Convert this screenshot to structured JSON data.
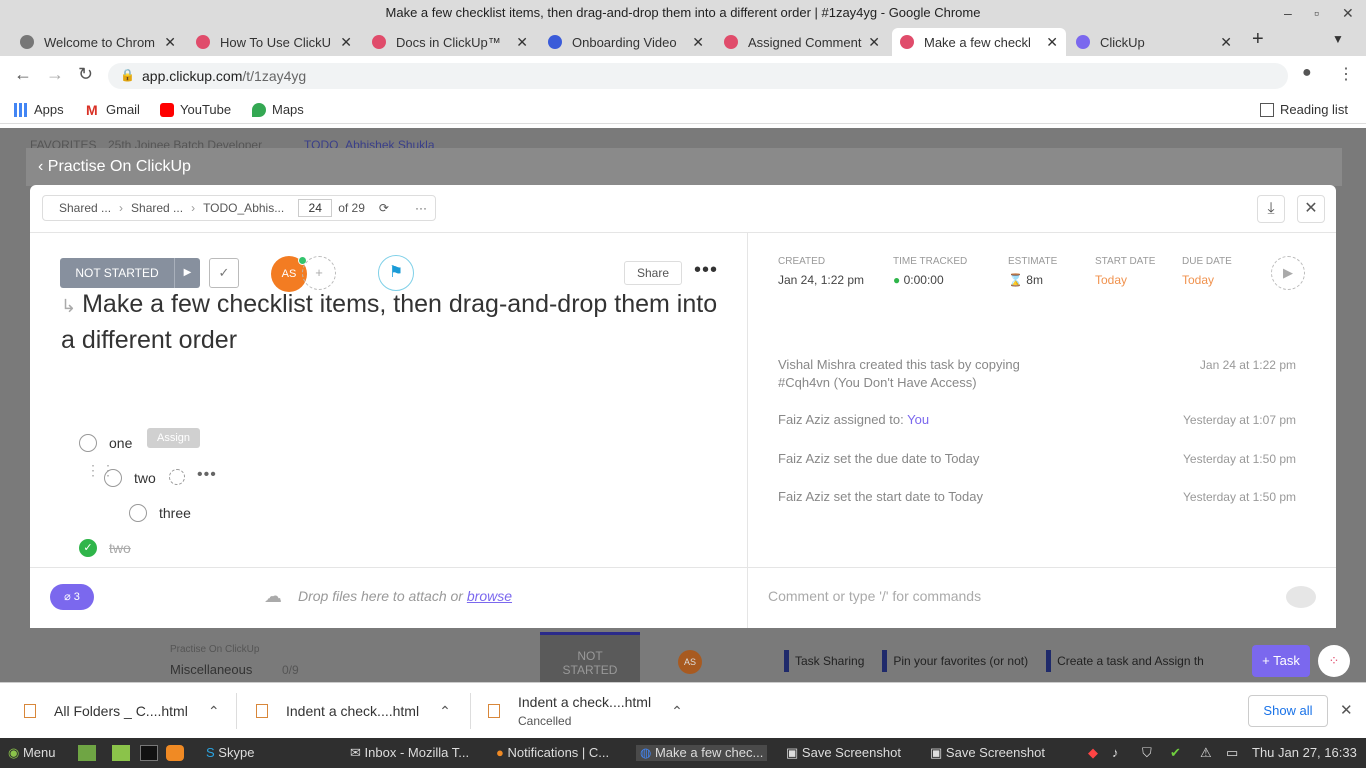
{
  "window": {
    "title": "Make a few checklist items, then drag-and-drop them into a different order | #1zay4yg - Google Chrome"
  },
  "tabs": [
    {
      "label": "Welcome to Chrom",
      "color": "#4285f4"
    },
    {
      "label": "How To Use ClickU",
      "color": "#e04c6b"
    },
    {
      "label": "Docs in ClickUp™",
      "color": "#e04c6b"
    },
    {
      "label": "Onboarding Video",
      "color": "#3a5bd9"
    },
    {
      "label": "Assigned Comment",
      "color": "#e04c6b"
    },
    {
      "label": "Make a few checkl",
      "color": "#e04c6b"
    },
    {
      "label": "ClickUp",
      "color": "#7b68ee"
    }
  ],
  "address": {
    "host": "app.clickup.com",
    "path": "/t/1zay4yg"
  },
  "bookmarks": {
    "apps": "Apps",
    "gmail": "Gmail",
    "youtube": "YouTube",
    "maps": "Maps",
    "reading_list": "Reading list"
  },
  "background": {
    "favorites": "FAVORITES",
    "batch": "25th Joinee Batch Developer",
    "todo": "TODO_Abhishek Shukla",
    "practise_small": "Practise On ClickUp",
    "misc": "Miscellaneous",
    "misc_count": "0/9",
    "not_started_1": "NOT",
    "not_started_2": "STARTED",
    "avatar": "AS",
    "chips": [
      "Task Sharing",
      "Pin your favorites (or not)",
      "Create a task and Assign th"
    ],
    "task_button": "Task"
  },
  "overlay": {
    "title": "Practise On ClickUp"
  },
  "breadcrumb": {
    "items": [
      "Shared ...",
      "Shared ...",
      "TODO_Abhis..."
    ],
    "index": "24",
    "of": "of 29"
  },
  "task": {
    "status": "NOT STARTED",
    "avatar": "AS",
    "share": "Share",
    "title": "Make a few checklist items, then drag-and-drop them into a different order"
  },
  "meta": {
    "created_label": "CREATED",
    "created": "Jan 24, 1:22 pm",
    "tracked_label": "TIME TRACKED",
    "tracked": "0:00:00",
    "estimate_label": "ESTIMATE",
    "estimate": "8m",
    "start_label": "START DATE",
    "start": "Today",
    "due_label": "DUE DATE",
    "due": "Today"
  },
  "checklist": {
    "tooltip": "Assign",
    "items": [
      {
        "text": "one",
        "done": false
      },
      {
        "text": "two",
        "done": false
      },
      {
        "text": "three",
        "done": false
      },
      {
        "text": "two",
        "done": true
      }
    ]
  },
  "activity": [
    {
      "text": "Vishal Mishra created this task by copying #Cqh4vn (You Don't Have Access)",
      "time": "Jan 24 at 1:22 pm"
    },
    {
      "text": "Faiz Aziz assigned to: ",
      "you": "You",
      "time": "Yesterday at 1:07 pm"
    },
    {
      "text": "Faiz Aziz set the due date to Today",
      "time": "Yesterday at 1:50 pm"
    },
    {
      "text": "Faiz Aziz set the start date to Today",
      "time": "Yesterday at 1:50 pm"
    }
  ],
  "footer": {
    "attachments": "3",
    "drop_text": "Drop files here to attach or ",
    "browse": "browse",
    "comment_placeholder": "Comment or type '/' for commands"
  },
  "downloads": [
    {
      "name": "All Folders _ C....html",
      "status": ""
    },
    {
      "name": "Indent a check....html",
      "status": ""
    },
    {
      "name": "Indent a check....html",
      "status": "Cancelled"
    }
  ],
  "show_all": "Show all",
  "taskbar": {
    "menu": "Menu",
    "skype": "Skype",
    "items": [
      "Inbox - Mozilla T...",
      "Notifications | C...",
      "Make a few chec...",
      "Save Screenshot",
      "Save Screenshot"
    ],
    "clock": "Thu Jan 27, 16:33"
  }
}
